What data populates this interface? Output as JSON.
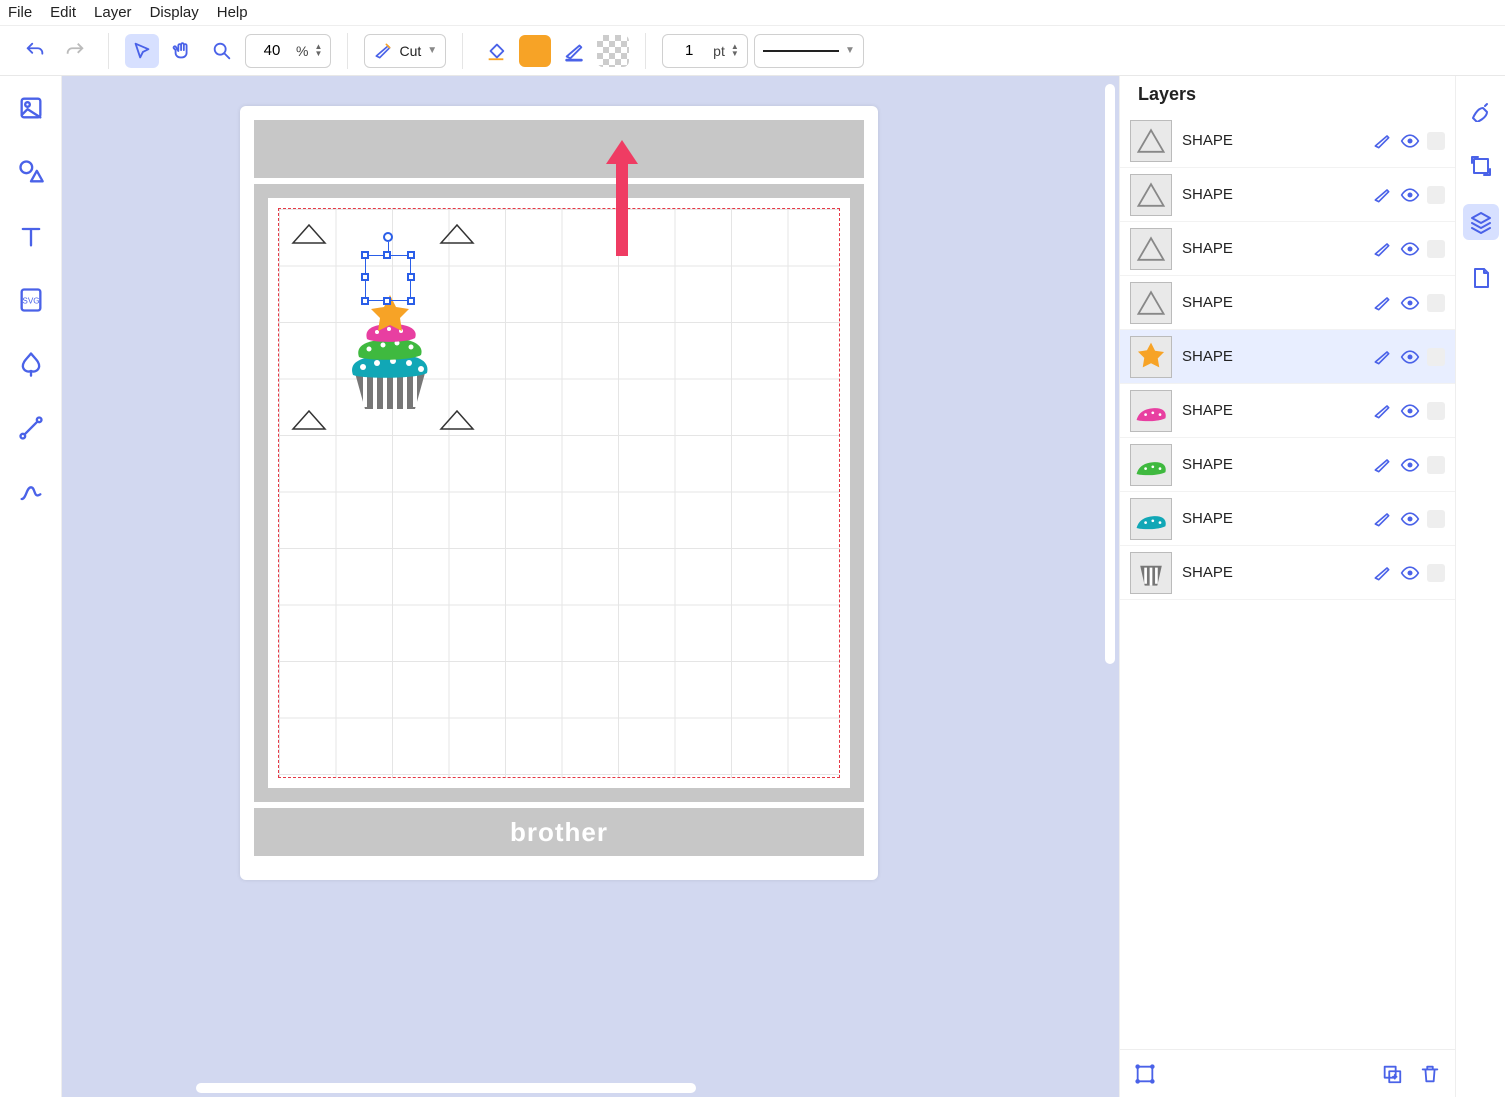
{
  "menu": {
    "file": "File",
    "edit": "Edit",
    "layer": "Layer",
    "display": "Display",
    "help": "Help"
  },
  "toolbar": {
    "zoom_value": "40",
    "zoom_unit": "%",
    "cut_mode": "Cut",
    "stroke_value": "1",
    "stroke_unit": "pt",
    "fill_color": "#f7a326"
  },
  "brand": "brother",
  "layers": {
    "title": "Layers",
    "items": [
      {
        "name": "SHAPE",
        "thumb": "triangle",
        "selected": false
      },
      {
        "name": "SHAPE",
        "thumb": "triangle",
        "selected": false
      },
      {
        "name": "SHAPE",
        "thumb": "triangle",
        "selected": false
      },
      {
        "name": "SHAPE",
        "thumb": "triangle",
        "selected": false
      },
      {
        "name": "SHAPE",
        "thumb": "star",
        "selected": true
      },
      {
        "name": "SHAPE",
        "thumb": "pink",
        "selected": false
      },
      {
        "name": "SHAPE",
        "thumb": "green",
        "selected": false
      },
      {
        "name": "SHAPE",
        "thumb": "teal",
        "selected": false
      },
      {
        "name": "SHAPE",
        "thumb": "cup",
        "selected": false
      }
    ]
  }
}
